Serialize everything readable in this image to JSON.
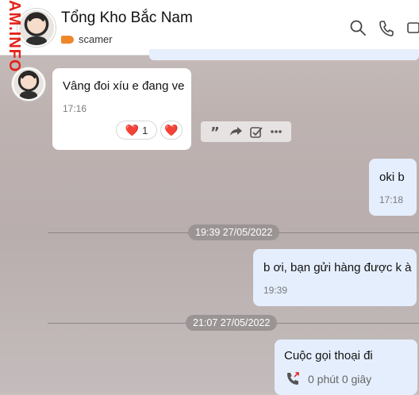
{
  "header": {
    "contact_name": "Tổng Kho Bắc Nam",
    "tag_label": "scamer",
    "tag_color": "#f0862c",
    "icons": [
      "search-icon",
      "phone-icon",
      "video-icon"
    ]
  },
  "watermark": "AM.INFO",
  "messages": {
    "incoming": {
      "text": "Vâng đoi xíu e đang ve",
      "time": "17:16",
      "reactions": [
        {
          "emoji": "❤️",
          "count": "1"
        },
        {
          "emoji": "❤️"
        }
      ]
    },
    "message_actions": [
      "quote-icon",
      "forward-icon",
      "task-icon",
      "more-icon"
    ],
    "out1": {
      "text": "oki b",
      "time": "17:18"
    },
    "date1": "19:39 27/05/2022",
    "out2": {
      "text": "b ơi, bạn gửi hàng được k à",
      "time": "19:39"
    },
    "date2": "21:07 27/05/2022",
    "call": {
      "title": "Cuộc gọi thoại đi",
      "duration": "0 phút 0 giây"
    }
  }
}
